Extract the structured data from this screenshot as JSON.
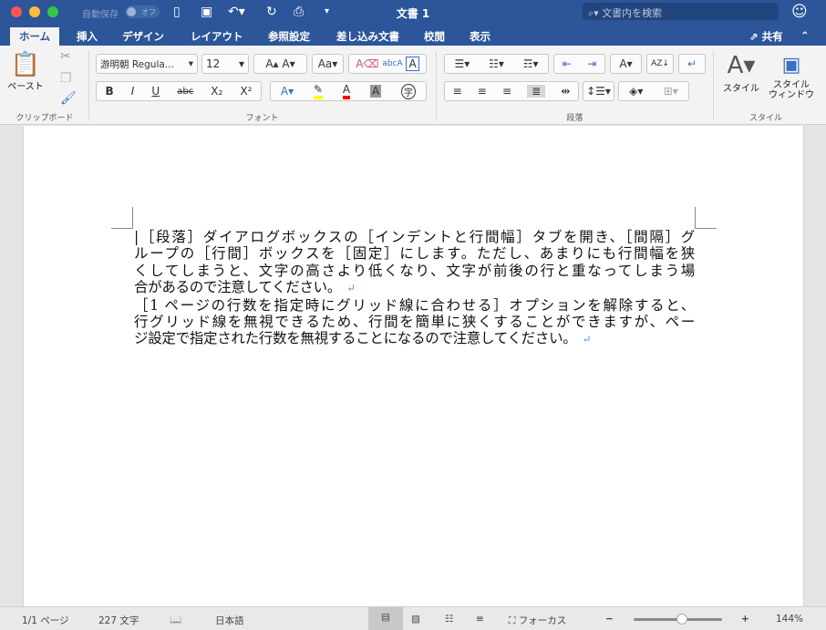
{
  "window": {
    "title": "文書 1",
    "autosave_label": "自動保存",
    "autosave_state": "オフ",
    "search_placeholder": "文書内を検索"
  },
  "tabs": [
    {
      "label": "ホーム",
      "active": true
    },
    {
      "label": "挿入"
    },
    {
      "label": "デザイン"
    },
    {
      "label": "レイアウト"
    },
    {
      "label": "参照設定"
    },
    {
      "label": "差し込み文書"
    },
    {
      "label": "校閲"
    },
    {
      "label": "表示"
    }
  ],
  "share_label": "共有",
  "ribbon": {
    "clipboard": {
      "group": "クリップボード",
      "paste": "ペースト"
    },
    "font": {
      "group": "フォント",
      "font_name": "游明朝 Regula...",
      "font_size": "12",
      "bold": "B",
      "italic": "I",
      "underline": "U",
      "strike": "abc",
      "subscript": "X₂",
      "superscript": "X²",
      "highlight_color": "#ffff00",
      "font_color": "#ff0000",
      "enclose": "字"
    },
    "paragraph": {
      "group": "段落"
    },
    "styles": {
      "group": "スタイル",
      "styles": "スタイル",
      "styles_pane": "スタイル\nウィンドウ"
    }
  },
  "document": {
    "lines": [
      "|［段落］ダイアログボックスの［インデントと行間幅］タブを開き、［間隔］グ",
      "ループの［行間］ボックスを［固定］にします。ただし、あまりにも行間幅を狭",
      "くしてしまうと、文字の高さより低くなり、文字が前後の行と重なってしまう場",
      "合があるので注意してください。",
      "［1 ページの行数を指定時にグリッド線に合わせる］オプションを解除すると、",
      "行グリッド線を無視できるため、行間を簡単に狭くすることができますが、ペー",
      "ジ設定で指定された行数を無視することになるので注意してください。"
    ],
    "paragraph_mark": "↵"
  },
  "status": {
    "page": "1/1 ページ",
    "words": "227 文字",
    "language": "日本語",
    "focus": "フォーカス",
    "zoom": "144%",
    "zoom_level": 0.55
  }
}
